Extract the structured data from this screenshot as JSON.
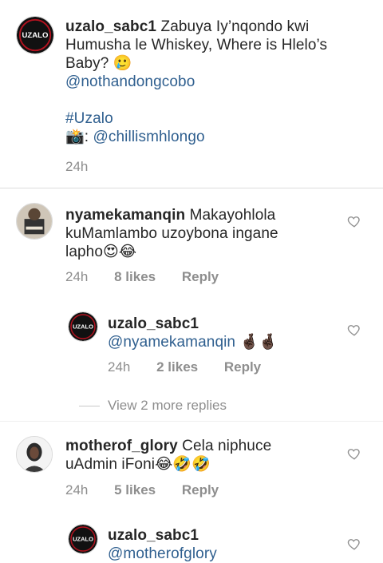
{
  "caption": {
    "username": "uzalo_sabc1",
    "text_line1": " Zabuya Iy’nqondo kwi",
    "text_line2": "Humusha le Whiskey, Where is Hlelo’s",
    "text_line3": "Baby? ",
    "emoji": "🥲",
    "mention": "@nothandongcobo",
    "hashtag": "#Uzalo",
    "camera_emoji": "📸",
    "photo_credit_prefix": ": ",
    "photo_credit": "@chillismhlongo",
    "time": "24h"
  },
  "comments": [
    {
      "username": "nyamekamanqin",
      "text_line1": " Makayohlola",
      "text_line2": "kuMamlambo uzoybona ingane",
      "text_line3": "lapho",
      "emojis": "😍😂",
      "time": "24h",
      "likes": "8 likes",
      "reply_label": "Reply"
    },
    {
      "username": "motherof_glory",
      "text_line1": " Cela niphuce",
      "text_line2": "uAdmin iFoni",
      "emojis": "😂🤣🤣",
      "time": "24h",
      "likes": "5 likes",
      "reply_label": "Reply"
    }
  ],
  "replies": [
    {
      "username": "uzalo_sabc1",
      "mention": "@nyamekamanqin",
      "emojis": "🤞🏿🤞🏿",
      "time": "24h",
      "likes": "2 likes",
      "reply_label": "Reply"
    },
    {
      "username": "uzalo_sabc1",
      "partial_text": "@motherofglory"
    }
  ],
  "view_more": "View 2 more replies",
  "avatar_text": "UZALO",
  "colors": {
    "link": "#2f5f8f",
    "muted": "#8e8e8e",
    "brand_red": "#b3121f"
  },
  "icons": [
    "heart-icon"
  ]
}
